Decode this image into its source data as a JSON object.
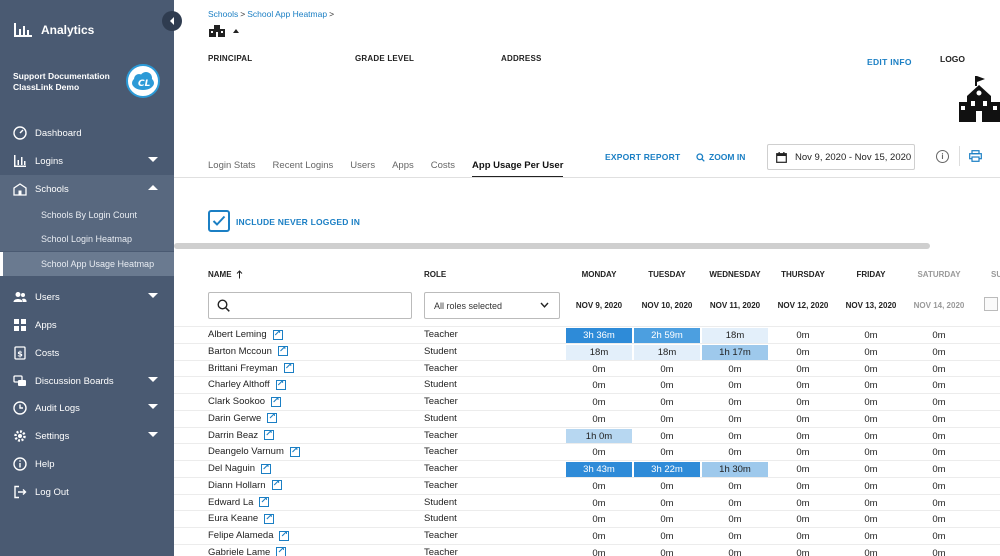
{
  "sidebar": {
    "brand": "Analytics",
    "org_line1": "Support Documentation",
    "org_line2": "ClassLink Demo",
    "nav": [
      {
        "label": "Dashboard",
        "icon": "dashboard-icon"
      },
      {
        "label": "Logins",
        "icon": "bar-chart-icon",
        "expandable": true
      },
      {
        "label": "Schools",
        "icon": "school-icon",
        "expanded": true
      },
      {
        "label": "Users",
        "icon": "users-icon",
        "expandable": true
      },
      {
        "label": "Apps",
        "icon": "apps-grid-icon"
      },
      {
        "label": "Costs",
        "icon": "dollar-icon"
      },
      {
        "label": "Discussion Boards",
        "icon": "chat-icon",
        "expandable": true
      },
      {
        "label": "Audit Logs",
        "icon": "clock-icon",
        "expandable": true
      },
      {
        "label": "Settings",
        "icon": "gear-icon",
        "expandable": true
      },
      {
        "label": "Help",
        "icon": "info-icon"
      },
      {
        "label": "Log Out",
        "icon": "logout-icon"
      }
    ],
    "schools_sub": [
      "Schools By Login Count",
      "School Login Heatmap",
      "School App Usage Heatmap"
    ]
  },
  "breadcrumb": {
    "schools": "Schools",
    "page": "School App Heatmap",
    "sep": ">"
  },
  "info": {
    "principal": "PRINCIPAL",
    "grade_level": "GRADE LEVEL",
    "address": "ADDRESS",
    "edit_info": "EDIT INFO",
    "logo": "LOGO"
  },
  "tabs": [
    "Login Stats",
    "Recent Logins",
    "Users",
    "Apps",
    "Costs",
    "App Usage Per User"
  ],
  "toolbar": {
    "export_report": "EXPORT REPORT",
    "zoom_in": "ZOOM IN",
    "date_range": "Nov 9, 2020 - Nov 15, 2020"
  },
  "filters": {
    "include_never_logged_in": "INCLUDE NEVER LOGGED IN",
    "include_checked": true,
    "role_select": "All roles selected"
  },
  "table": {
    "name_header": "NAME",
    "role_header": "ROLE",
    "days": [
      {
        "day": "MONDAY",
        "date": "NOV 9, 2020"
      },
      {
        "day": "TUESDAY",
        "date": "NOV 10, 2020"
      },
      {
        "day": "WEDNESDAY",
        "date": "NOV 11, 2020"
      },
      {
        "day": "THURSDAY",
        "date": "NOV 12, 2020"
      },
      {
        "day": "FRIDAY",
        "date": "NOV 13, 2020"
      },
      {
        "day": "SATURDAY",
        "date": "NOV 14, 2020"
      },
      {
        "day": "SU",
        "date": ""
      }
    ],
    "rows": [
      {
        "name": "Albert Leming",
        "role": "Teacher",
        "usage": [
          "3h 36m",
          "2h 59m",
          "18m",
          "0m",
          "0m",
          "0m"
        ]
      },
      {
        "name": "Barton Mccoun",
        "role": "Student",
        "usage": [
          "18m",
          "18m",
          "1h 17m",
          "0m",
          "0m",
          "0m"
        ]
      },
      {
        "name": "Brittani Freyman",
        "role": "Teacher",
        "usage": [
          "0m",
          "0m",
          "0m",
          "0m",
          "0m",
          "0m"
        ]
      },
      {
        "name": "Charley Althoff",
        "role": "Student",
        "usage": [
          "0m",
          "0m",
          "0m",
          "0m",
          "0m",
          "0m"
        ]
      },
      {
        "name": "Clark Sookoo",
        "role": "Teacher",
        "usage": [
          "0m",
          "0m",
          "0m",
          "0m",
          "0m",
          "0m"
        ]
      },
      {
        "name": "Darin Gerwe",
        "role": "Student",
        "usage": [
          "0m",
          "0m",
          "0m",
          "0m",
          "0m",
          "0m"
        ]
      },
      {
        "name": "Darrin Beaz",
        "role": "Teacher",
        "usage": [
          "1h 0m",
          "0m",
          "0m",
          "0m",
          "0m",
          "0m"
        ]
      },
      {
        "name": "Deangelo Varnum",
        "role": "Teacher",
        "usage": [
          "0m",
          "0m",
          "0m",
          "0m",
          "0m",
          "0m"
        ]
      },
      {
        "name": "Del Naguin",
        "role": "Teacher",
        "usage": [
          "3h 43m",
          "3h 22m",
          "1h 30m",
          "0m",
          "0m",
          "0m"
        ]
      },
      {
        "name": "Diann Hollarn",
        "role": "Teacher",
        "usage": [
          "0m",
          "0m",
          "0m",
          "0m",
          "0m",
          "0m"
        ]
      },
      {
        "name": "Edward La",
        "role": "Student",
        "usage": [
          "0m",
          "0m",
          "0m",
          "0m",
          "0m",
          "0m"
        ]
      },
      {
        "name": "Eura Keane",
        "role": "Student",
        "usage": [
          "0m",
          "0m",
          "0m",
          "0m",
          "0m",
          "0m"
        ]
      },
      {
        "name": "Felipe Alameda",
        "role": "Teacher",
        "usage": [
          "0m",
          "0m",
          "0m",
          "0m",
          "0m",
          "0m"
        ]
      },
      {
        "name": "Gabriele Lame",
        "role": "Teacher",
        "usage": [
          "0m",
          "0m",
          "0m",
          "0m",
          "0m",
          "0m"
        ]
      }
    ]
  },
  "colors": {
    "sidebar": "#4a5a72",
    "accent": "#1b7fc4",
    "heat_high": "#2e8bd8",
    "heat_low": "#e3effa"
  }
}
